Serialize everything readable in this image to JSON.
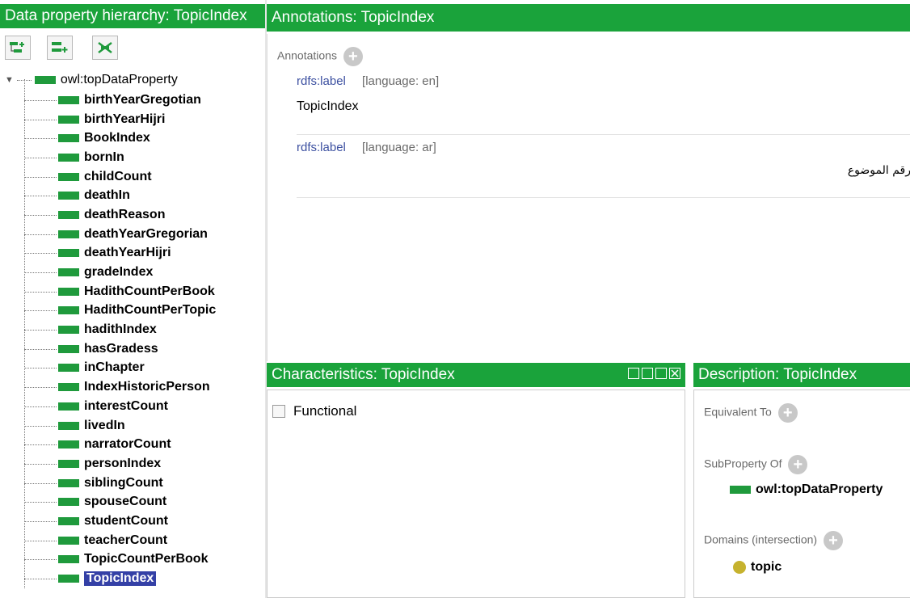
{
  "left_panel": {
    "title": "Data property hierarchy: TopicIndex",
    "toolbar": [
      {
        "icon": "add-subproperty-icon"
      },
      {
        "icon": "add-sibling-property-icon"
      },
      {
        "icon": "delete-property-icon"
      }
    ],
    "root_label": "owl:topDataProperty",
    "items": [
      {
        "label": "birthYearGregotian"
      },
      {
        "label": "birthYearHijri"
      },
      {
        "label": "BookIndex"
      },
      {
        "label": "bornIn"
      },
      {
        "label": "childCount"
      },
      {
        "label": "deathIn"
      },
      {
        "label": "deathReason"
      },
      {
        "label": "deathYearGregorian"
      },
      {
        "label": "deathYearHijri"
      },
      {
        "label": "gradeIndex"
      },
      {
        "label": "HadithCountPerBook"
      },
      {
        "label": "HadithCountPerTopic"
      },
      {
        "label": "hadithIndex"
      },
      {
        "label": "hasGradess"
      },
      {
        "label": "inChapter"
      },
      {
        "label": "IndexHistoricPerson"
      },
      {
        "label": "interestCount"
      },
      {
        "label": "livedIn"
      },
      {
        "label": "narratorCount"
      },
      {
        "label": "personIndex"
      },
      {
        "label": "siblingCount"
      },
      {
        "label": "spouseCount"
      },
      {
        "label": "studentCount"
      },
      {
        "label": "teacherCount"
      },
      {
        "label": "TopicCountPerBook"
      },
      {
        "label": "TopicIndex"
      }
    ],
    "selected_item": "TopicIndex"
  },
  "annotations": {
    "title": "Annotations: TopicIndex",
    "section_label": "Annotations",
    "entries": [
      {
        "property": "rdfs:label",
        "lang": "[language: en]",
        "value": "TopicIndex"
      },
      {
        "property": "rdfs:label",
        "lang": "[language: ar]",
        "value": "رقم الموضوع"
      }
    ]
  },
  "characteristics": {
    "title": "Characteristics: TopicIndex",
    "options": [
      {
        "label": "Functional",
        "checked": false
      }
    ]
  },
  "description": {
    "title": "Description: TopicIndex",
    "equivalent_to": "Equivalent To",
    "subproperty_of": "SubProperty Of",
    "subproperty_value": "owl:topDataProperty",
    "domains_label": "Domains (intersection)",
    "domain_value": "topic"
  },
  "colors": {
    "header_green": "#1aa33b",
    "property_green": "#1f9a3c",
    "selection_blue": "#3440a6",
    "link_blue": "#3b4fa0",
    "class_olive": "#c6b22e"
  }
}
